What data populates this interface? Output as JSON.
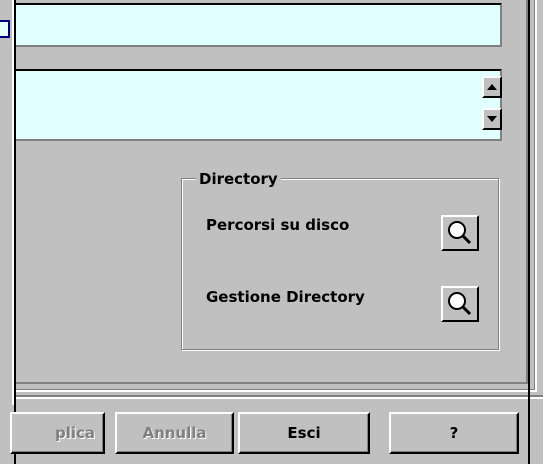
{
  "directory_group": {
    "title": "Directory",
    "percorsi_label": "Percorsi su disco",
    "gestione_label": "Gestione Directory"
  },
  "buttons": {
    "applica": "plica",
    "annulla": "Annulla",
    "esci": "Esci",
    "help": "?"
  },
  "icons": {
    "magnifier": "magnifier-icon",
    "scroll_up": "arrow-up-icon",
    "scroll_down": "arrow-down-icon"
  },
  "colors": {
    "window_bg": "#c0c0c0",
    "field_bg": "#e0ffff",
    "disabled_text": "#808080"
  }
}
